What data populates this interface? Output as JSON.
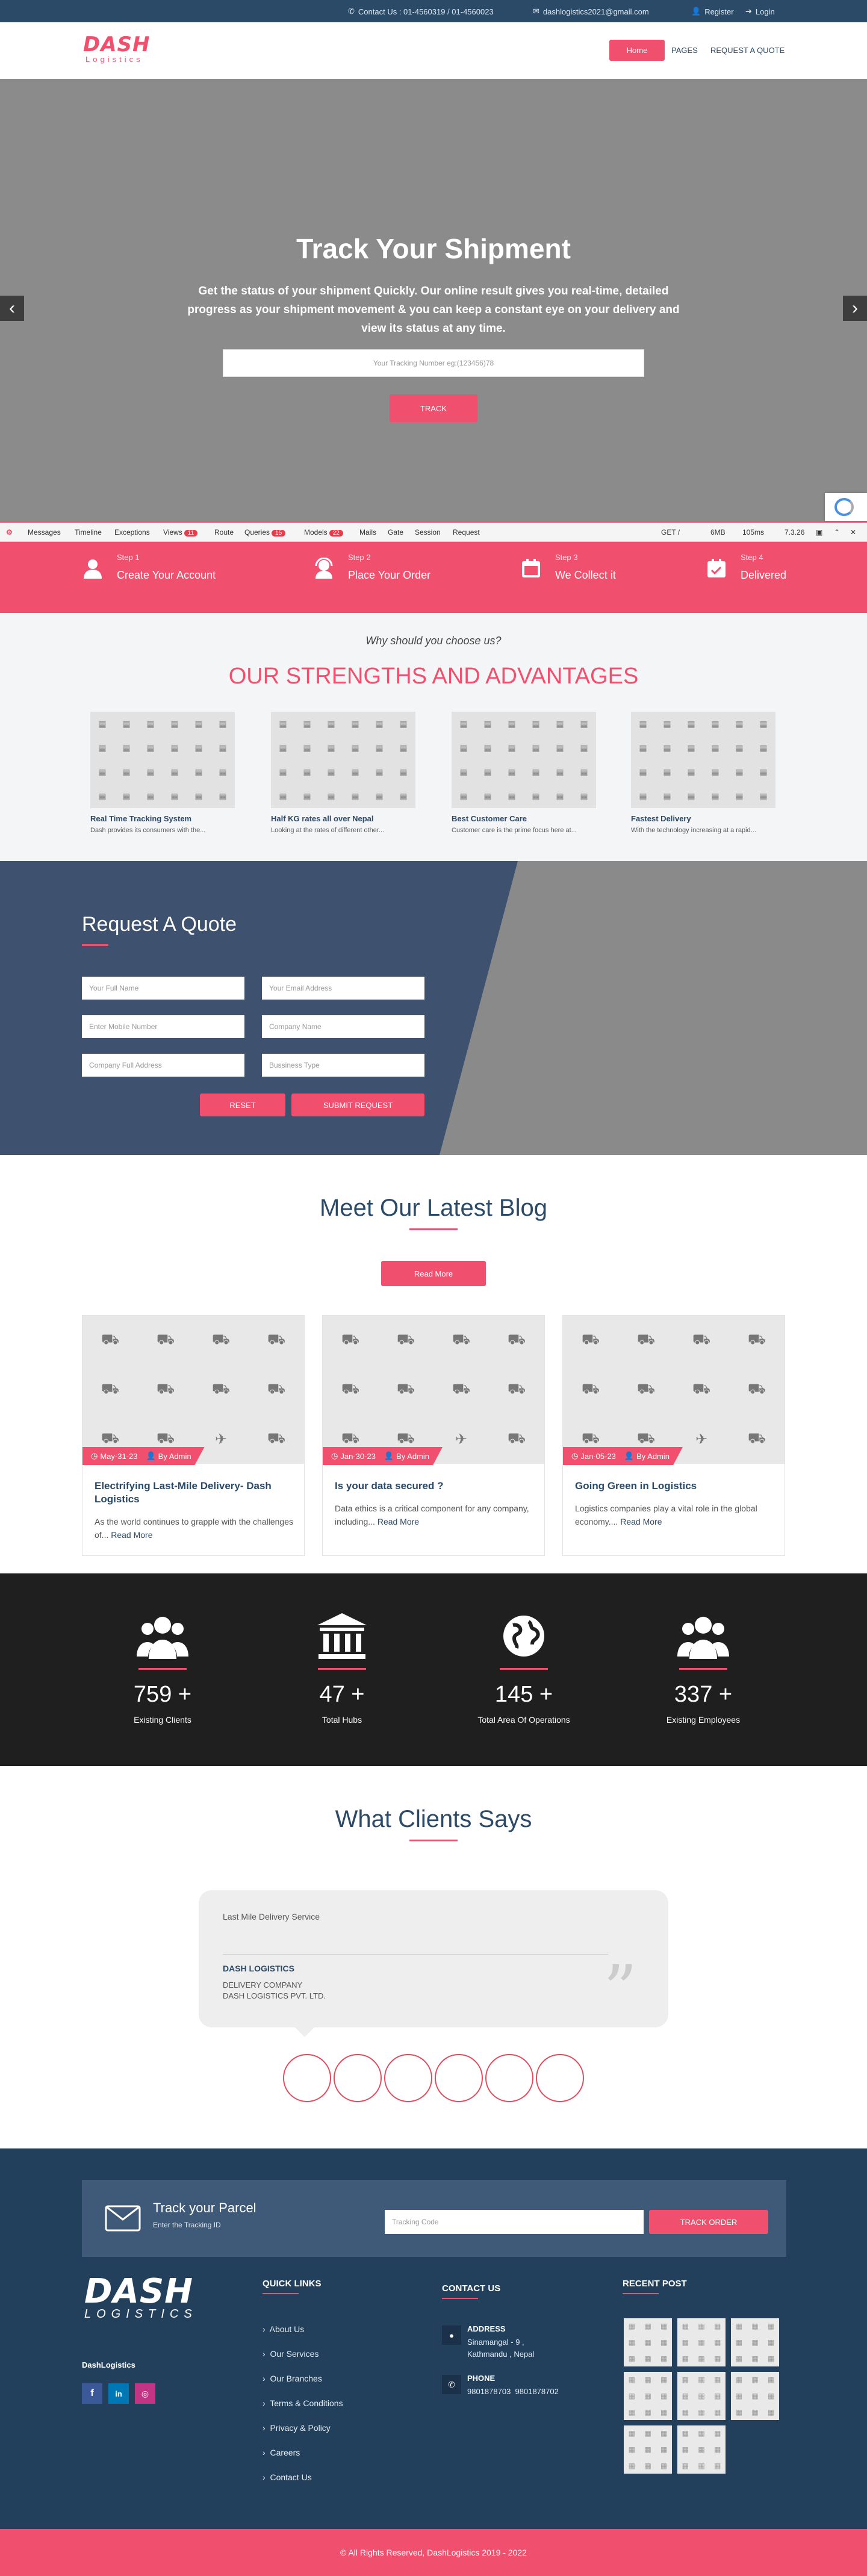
{
  "topbar": {
    "contact": "Contact Us : 01-4560319 / 01-4560023",
    "email": "dashlogistics2021@gmail.com",
    "register": "Register",
    "login": "Login"
  },
  "nav": {
    "logo_main": "DASH",
    "logo_sub": "Logistics",
    "items": [
      "Home",
      "PAGES",
      "REQUEST A QUOTE"
    ]
  },
  "hero": {
    "title": "Track Your Shipment",
    "subtitle": "Get the status of your shipment Quickly. Our online result gives you real-time, detailed progress as your shipment movement & you can keep a constant eye on your delivery and view its status at any time.",
    "placeholder": "Your Tracking Number eg:(123456)78",
    "button": "TRACK",
    "prev": "‹",
    "next": "›"
  },
  "debugbar": {
    "items": [
      "Messages",
      "Timeline",
      "Exceptions",
      "Views",
      "Route",
      "Queries",
      "Models",
      "Mails",
      "Gate",
      "Session",
      "Request"
    ],
    "badges": {
      "views": "11",
      "queries": "15",
      "models": "22"
    },
    "method": "GET /",
    "memory": "6MB",
    "time": "105ms",
    "version": "7.3.26"
  },
  "steps": [
    {
      "num": "Step 1",
      "title": "Create Your Account",
      "icon": "user-icon"
    },
    {
      "num": "Step 2",
      "title": "Place Your Order",
      "icon": "support-icon"
    },
    {
      "num": "Step 3",
      "title": "We Collect it",
      "icon": "calendar-icon"
    },
    {
      "num": "Step 4",
      "title": "Delivered",
      "icon": "calendar-check-icon"
    }
  ],
  "why": {
    "kicker": "Why should you choose us?",
    "title": "OUR STRENGTHS AND ADVANTAGES",
    "cards": [
      {
        "title": "Real Time Tracking System",
        "desc": "Dash provides its consumers with the..."
      },
      {
        "title": "Half KG rates all over Nepal",
        "desc": "Looking at the rates of different other..."
      },
      {
        "title": "Best Customer Care",
        "desc": "Customer care is the prime focus here at..."
      },
      {
        "title": "Fastest Delivery",
        "desc": "With the technology increasing at a rapid..."
      }
    ]
  },
  "quote": {
    "title": "Request A Quote",
    "fields": [
      "Your Full Name",
      "Your Email Address",
      "Enter Mobile Number",
      "Company Name",
      "Company Full Address",
      "Bussiness Type"
    ],
    "reset": "RESET",
    "submit": "SUBMIT REQUEST"
  },
  "blog": {
    "title": "Meet Our Latest Blog",
    "read_more_btn": "Read More",
    "posts": [
      {
        "date": "May-31-23",
        "author": "By Admin",
        "title": "Electrifying Last-Mile Delivery- Dash Logistics",
        "excerpt": "As the world continues to grapple with the challenges of...",
        "link": "Read More"
      },
      {
        "date": "Jan-30-23",
        "author": "By Admin",
        "title": "Is your data secured ?",
        "excerpt": "Data ethics is a critical component for any company, including...",
        "link": "Read More"
      },
      {
        "date": "Jan-05-23",
        "author": "By Admin",
        "title": "Going Green in Logistics",
        "excerpt": "Logistics companies play a vital role in the global economy....",
        "link": "Read More"
      }
    ]
  },
  "stats": [
    {
      "value": "759 +",
      "label": "Existing Clients",
      "icon": "users-icon"
    },
    {
      "value": "47 +",
      "label": "Total Hubs",
      "icon": "bank-icon"
    },
    {
      "value": "145 +",
      "label": "Total Area Of Operations",
      "icon": "globe-icon"
    },
    {
      "value": "337 +",
      "label": "Existing Employees",
      "icon": "users-icon"
    }
  ],
  "clients": {
    "title": "What Clients Says",
    "quote": "Last Mile Delivery Service",
    "company": "DASH LOGISTICS",
    "role": "DELIVERY COMPANY",
    "org": "DASH LOGISTICS PVT. LTD."
  },
  "footer": {
    "track_title": "Track your Parcel",
    "track_sub": "Enter the Tracking ID",
    "track_placeholder": "Tracking Code",
    "track_button": "TRACK ORDER",
    "logo_main": "DASH",
    "logo_sub": "LOGISTICS",
    "brand": "DashLogistics",
    "quick_title": "QUICK LINKS",
    "links": [
      "About Us",
      "Our Services",
      "Our Branches",
      "Terms & Conditions",
      "Privacy & Policy",
      "Careers",
      "Contact Us"
    ],
    "contact_title": "CONTACT US",
    "address_label": "ADDRESS",
    "address": "Sinamangal - 9 , Kathmandu , Nepal",
    "phone_label": "PHONE",
    "phone": "9801878703  9801878702",
    "recent_title": "RECENT POST",
    "copyright": "© All Rights Reserved, DashLogistics 2019 - 2022"
  },
  "colors": {
    "accent": "#f0506e",
    "navy": "#2b4a68",
    "footer": "#22405c"
  }
}
